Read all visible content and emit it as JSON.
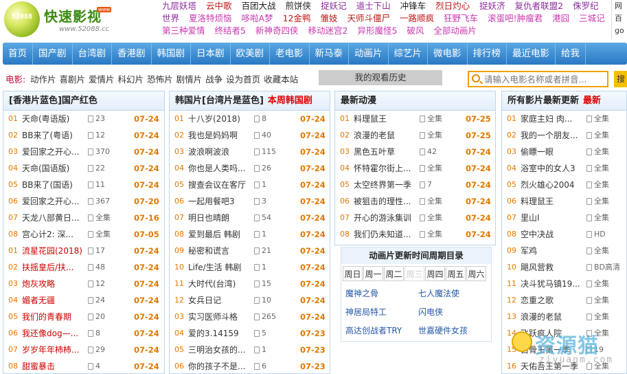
{
  "logo": {
    "circle_text": "52088",
    "name": "快速影视",
    "badge": "www",
    "url": "www.52088.cc"
  },
  "hot_rows": [
    [
      {
        "t": "九层妖塔",
        "c": "#8a2b9a"
      },
      {
        "t": "云中歌",
        "c": "#c01818"
      },
      {
        "t": "百团大战",
        "c": "#222"
      },
      {
        "t": "煎饼侠",
        "c": "#222"
      },
      {
        "t": "捉妖记",
        "c": "#8a2b9a"
      },
      {
        "t": "道士下山",
        "c": "#8a2b9a"
      },
      {
        "t": "冲锋车",
        "c": "#222"
      },
      {
        "t": "烈日灼心",
        "c": "#c01818"
      },
      {
        "t": "捉妖济",
        "c": "#8a2b9a"
      },
      {
        "t": "复仇者联盟2",
        "c": "#8a2b9a"
      },
      {
        "t": "侏罗纪",
        "c": "#8a2b9a"
      }
    ],
    [
      {
        "t": "世界",
        "c": "#8a2b9a"
      },
      {
        "t": "夏洛特烦恼",
        "c": "#c83ab0"
      },
      {
        "t": "哆啦A梦",
        "c": "#c83ab0"
      },
      {
        "t": "12金鸭",
        "c": "#c01818"
      },
      {
        "t": "雏妓",
        "c": "#c01818"
      },
      {
        "t": "天师斗僵尸",
        "c": "#c01818"
      },
      {
        "t": "一路顺疯",
        "c": "#c01818"
      },
      {
        "t": "狂野飞车",
        "c": "#c83ab0"
      },
      {
        "t": "滚蛋吧!肿瘤君",
        "c": "#c83ab0"
      },
      {
        "t": "港囧",
        "c": "#c83ab0"
      },
      {
        "t": "三城记",
        "c": "#c83ab0"
      }
    ],
    [
      {
        "t": "第三种爱情",
        "c": "#c83ab0"
      },
      {
        "t": "终结者5",
        "c": "#c83ab0"
      },
      {
        "t": "新神奇四侠",
        "c": "#c83ab0"
      },
      {
        "t": "移动迷宫2",
        "c": "#c83ab0"
      },
      {
        "t": "异形魔怪5",
        "c": "#c83ab0"
      },
      {
        "t": "破风",
        "c": "#c83ab0"
      },
      {
        "t": "全部动画片",
        "c": "#c83ab0"
      }
    ]
  ],
  "right_cut": [
    "网",
    "百",
    "go"
  ],
  "nav": [
    "首页",
    "国产剧",
    "台湾剧",
    "香港剧",
    "韩国剧",
    "日本剧",
    "欧美剧",
    "老电影",
    "新马泰",
    "动画片",
    "综艺片",
    "微电影",
    "排行榜",
    "最近电影",
    "给我"
  ],
  "subnav": {
    "label": "电影:",
    "links": [
      "动作片",
      "喜剧片",
      "爱情片",
      "科幻片",
      "恐怖片",
      "剧情片",
      "战争",
      "设为首页",
      "收藏本站"
    ],
    "history": "我的观看历史",
    "search_placeholder": "请输入电影名称或者拼音...",
    "search_button": "搜"
  },
  "panels": [
    {
      "title": "[香港片蓝色]国产红色",
      "tag": "",
      "rows": [
        {
          "n": "01",
          "t": "天命(粤语版)",
          "e": "23",
          "d": "07-24",
          "r": false
        },
        {
          "n": "02",
          "t": "BB来了(粤语)",
          "e": "12",
          "d": "07-24",
          "r": false
        },
        {
          "n": "03",
          "t": "爱回家之开心...",
          "e": "370",
          "d": "07-24",
          "r": false
        },
        {
          "n": "04",
          "t": "天命(国语版)",
          "e": "22",
          "d": "07-24",
          "r": false
        },
        {
          "n": "05",
          "t": "BB来了(国语)",
          "e": "11",
          "d": "07-24",
          "r": false
        },
        {
          "n": "06",
          "t": "爱回家之开心...",
          "e": "367",
          "d": "07-20",
          "r": false
        },
        {
          "n": "07",
          "t": "天龙八部黄日...",
          "e": "全集",
          "d": "07-16",
          "r": false
        },
        {
          "n": "08",
          "t": "宫心计2: 深...",
          "e": "全集",
          "d": "07-05",
          "r": false
        },
        {
          "n": "01",
          "t": "流星花园(2018)",
          "e": "17",
          "d": "07-24",
          "r": true
        },
        {
          "n": "02",
          "t": "扶摇皇后/扶...",
          "e": "48",
          "d": "07-24",
          "r": true
        },
        {
          "n": "03",
          "t": "炮灰攻略",
          "e": "12",
          "d": "07-24",
          "r": true
        },
        {
          "n": "04",
          "t": "媚者无疆",
          "e": "24",
          "d": "07-24",
          "r": true
        },
        {
          "n": "05",
          "t": "我们的青春期",
          "e": "20",
          "d": "07-24",
          "r": true
        },
        {
          "n": "06",
          "t": "我还像dog—...",
          "e": "8",
          "d": "07-24",
          "r": true
        },
        {
          "n": "07",
          "t": "岁岁年年柿柿...",
          "e": "29",
          "d": "07-24",
          "r": true
        },
        {
          "n": "08",
          "t": "甜蜜暴击",
          "e": "4",
          "d": "07-24",
          "r": true
        }
      ]
    },
    {
      "title": "韩国片[台湾片是蓝色]",
      "tag": "本周韩国剧",
      "rows": [
        {
          "n": "01",
          "t": "十八岁(2018)",
          "e": "8",
          "d": "07-24",
          "r": false
        },
        {
          "n": "02",
          "t": "我也是妈妈啊",
          "e": "40",
          "d": "07-24",
          "r": false
        },
        {
          "n": "03",
          "t": "波浪啊波浪",
          "e": "115",
          "d": "07-24",
          "r": false
        },
        {
          "n": "04",
          "t": "你也是人类吗...",
          "e": "26",
          "d": "07-24",
          "r": false
        },
        {
          "n": "05",
          "t": "搜查会议在客厅",
          "e": "1",
          "d": "07-24",
          "r": false
        },
        {
          "n": "06",
          "t": "一起用餐吧3",
          "e": "3",
          "d": "07-24",
          "r": false
        },
        {
          "n": "07",
          "t": "明日也晴朗",
          "e": "54",
          "d": "07-24",
          "r": false
        },
        {
          "n": "08",
          "t": "爱到最后 韩剧",
          "e": "1",
          "d": "07-24",
          "r": false
        },
        {
          "n": "09",
          "t": "秘密和谎言",
          "e": "21",
          "d": "07-24",
          "r": false
        },
        {
          "n": "10",
          "t": "Life/生活 韩剧",
          "e": "1",
          "d": "07-24",
          "r": false
        },
        {
          "n": "11",
          "t": "大时代(台湾)",
          "e": "15",
          "d": "07-24",
          "r": false
        },
        {
          "n": "12",
          "t": "女兵日记",
          "e": "10",
          "d": "07-24",
          "r": false
        },
        {
          "n": "03",
          "t": "实习医师斗格",
          "e": "265",
          "d": "07-24",
          "r": false
        },
        {
          "n": "04",
          "t": "爱的3.14159",
          "e": "5",
          "d": "07-23",
          "r": false
        },
        {
          "n": "05",
          "t": "三明治女孩的...",
          "e": "1",
          "d": "07-23",
          "r": false
        },
        {
          "n": "06",
          "t": "你的孩子不是...",
          "e": "6",
          "d": "07-23",
          "r": false
        }
      ]
    },
    {
      "title": "最新动漫",
      "tag": "",
      "rows": [
        {
          "n": "01",
          "t": "料理鼠王",
          "e": "全集",
          "d": "07-25",
          "r": false
        },
        {
          "n": "02",
          "t": "浪漫的老鼠",
          "e": "全集",
          "d": "07-25",
          "r": false
        },
        {
          "n": "03",
          "t": "黑色五叶草",
          "e": "42",
          "d": "07-24",
          "r": false
        },
        {
          "n": "04",
          "t": "怀特霍尔街上...",
          "e": "全集",
          "d": "07-24",
          "r": false
        },
        {
          "n": "05",
          "t": "太空终界第一季",
          "e": "7",
          "d": "07-24",
          "r": false
        },
        {
          "n": "06",
          "t": "被狙击的理性...",
          "e": "全集",
          "d": "07-24",
          "r": false
        },
        {
          "n": "07",
          "t": "开心的游泳集训",
          "e": "全集",
          "d": "07-24",
          "r": false
        },
        {
          "n": "08",
          "t": "我们仍未知道...",
          "e": "全集",
          "d": "07-24",
          "r": false
        }
      ]
    },
    {
      "title": "所有影片最新更新",
      "tag": "最新",
      "rows": [
        {
          "n": "01",
          "t": "家庭主妇 肉...",
          "e": "全集",
          "d": "",
          "r": false
        },
        {
          "n": "02",
          "t": "我的一个朋友...",
          "e": "全集",
          "d": "",
          "r": false
        },
        {
          "n": "03",
          "t": "偷瞟一眼",
          "e": "全集",
          "d": "",
          "r": false
        },
        {
          "n": "04",
          "t": "浴室中的女人3",
          "e": "全集",
          "d": "",
          "r": false
        },
        {
          "n": "05",
          "t": "烈火雄心2004",
          "e": "全集",
          "d": "",
          "r": false
        },
        {
          "n": "06",
          "t": "料理鼠王",
          "e": "全集",
          "d": "",
          "r": false
        },
        {
          "n": "07",
          "t": "里山I",
          "e": "全集",
          "d": "",
          "r": false
        },
        {
          "n": "08",
          "t": "空中决战",
          "e": "HD",
          "d": "",
          "r": false
        },
        {
          "n": "09",
          "t": "军鸡",
          "e": "全集",
          "d": "",
          "r": false
        },
        {
          "n": "10",
          "t": "飓风营救",
          "e": "BD高清",
          "d": "",
          "r": false
        },
        {
          "n": "11",
          "t": "决斗犹马镇19...",
          "e": "全集",
          "d": "",
          "r": false
        },
        {
          "n": "12",
          "t": "恋重之歌",
          "e": "全集",
          "d": "",
          "r": false
        },
        {
          "n": "13",
          "t": "浪漫的老鼠",
          "e": "全集",
          "d": "",
          "r": false
        },
        {
          "n": "14",
          "t": "飞跃疯人院",
          "e": "全集",
          "d": "",
          "r": false
        },
        {
          "n": "15",
          "t": "白骨王第一季",
          "e": "19",
          "d": "",
          "r": false
        },
        {
          "n": "16",
          "t": "天佑吾王第一季",
          "e": "全集",
          "d": "",
          "r": false
        }
      ]
    }
  ],
  "schedule": {
    "title": "动画片更新时间周期目录",
    "days": [
      "周日",
      "周一",
      "周二",
      "周三",
      "周四",
      "周五",
      "周六"
    ],
    "active_index": 3,
    "items": [
      "魔神之骨",
      "七人魔法使",
      "神居局特工",
      "闪电侠",
      "高达创战者TRY",
      "世嘉硬件女孩"
    ]
  },
  "watermark": {
    "text": "资源猫",
    "url": "ziyuanm.com"
  }
}
